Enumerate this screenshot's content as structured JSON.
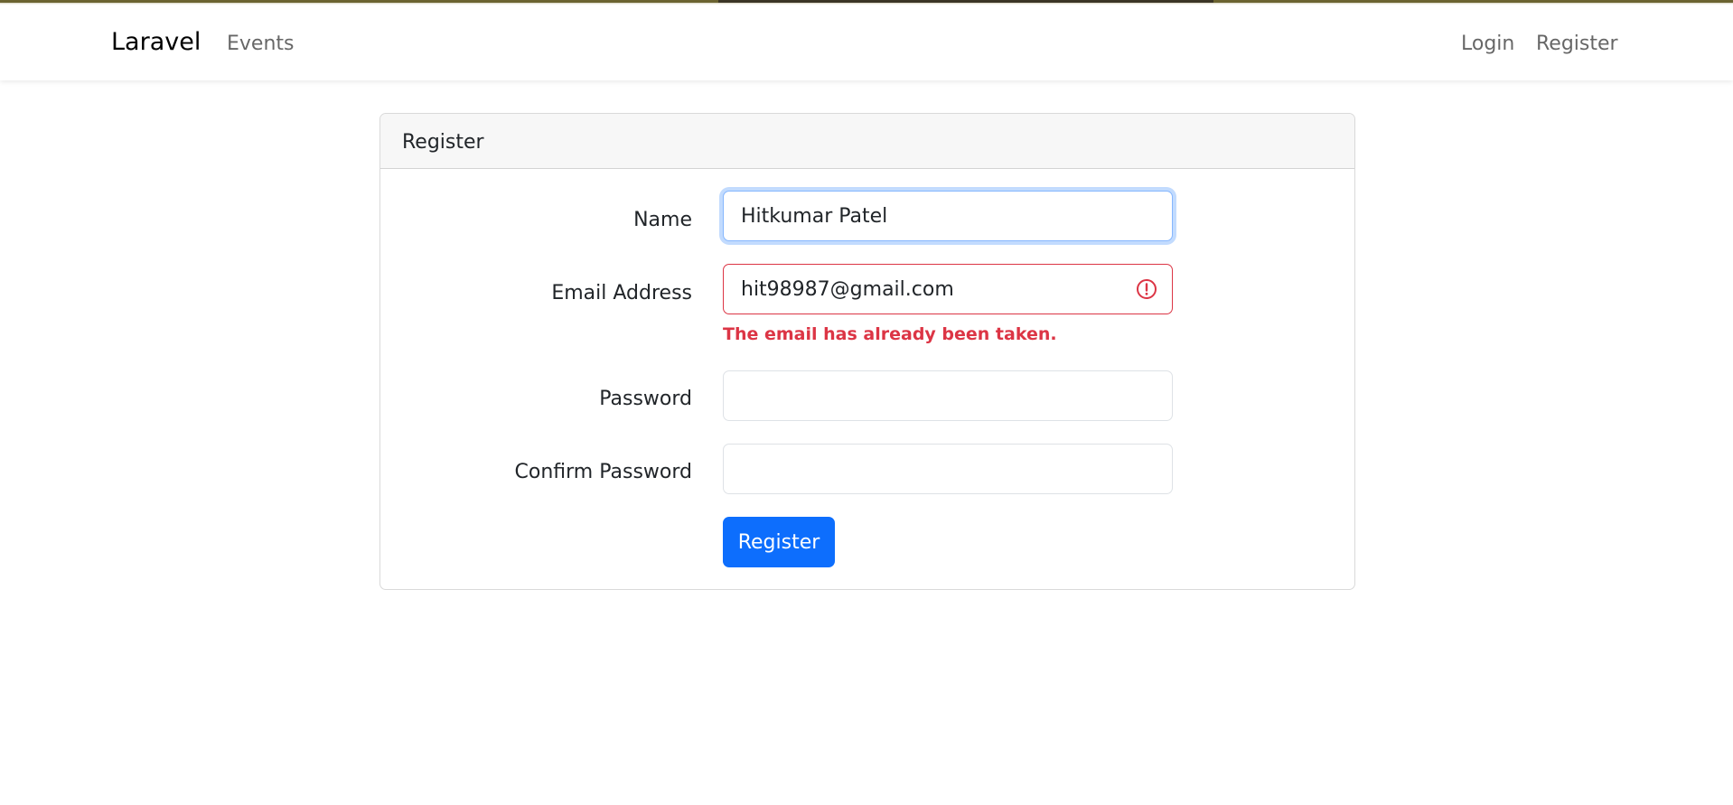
{
  "navbar": {
    "brand": "Laravel",
    "links": {
      "events": "Events"
    },
    "auth": {
      "login": "Login",
      "register": "Register"
    }
  },
  "card": {
    "title": "Register",
    "fields": {
      "name": {
        "label": "Name",
        "value": "Hitkumar Patel"
      },
      "email": {
        "label": "Email Address",
        "value": "hit98987@gmail.com",
        "error": "The email has already been taken."
      },
      "password": {
        "label": "Password",
        "value": ""
      },
      "confirm": {
        "label": "Confirm Password",
        "value": ""
      }
    },
    "submit_label": "Register"
  },
  "colors": {
    "primary": "#0d6efd",
    "danger": "#dc3545",
    "focus_border": "#86b7fe"
  }
}
